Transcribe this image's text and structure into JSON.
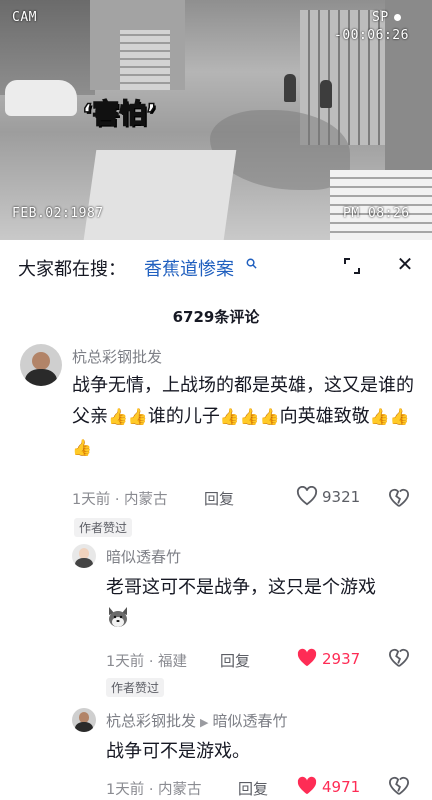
{
  "video": {
    "cam_label": "CAM",
    "sp_label": "SP",
    "time_counter": "-00:06:26",
    "date_stamp": "FEB.02:1987",
    "clock_stamp": "PM 08:26",
    "caption": "‘害怕’"
  },
  "search": {
    "lead": "大家都在搜：",
    "term": "香蕉道惨案",
    "search_icon": "search-icon",
    "expand_icon": "expand-icon",
    "close_icon": "close-icon"
  },
  "comments_count": "6729条评论",
  "comments": [
    {
      "username": "杭总彩钢批发",
      "text_part1": "战争无情，上战场的都是英雄，这又是谁的父亲",
      "text_part2": "谁的儿子",
      "text_part3": "向英雄致敬",
      "thumbs_emoji": "👍",
      "meta": "1天前 · 内蒙古",
      "reply": "回复",
      "likes": "9321",
      "liked": false,
      "author_tag": "作者赞过"
    },
    {
      "username": "暗似透春竹",
      "text": "老哥这可不是战争，这只是个游戏",
      "meta": "1天前 · 福建",
      "reply": "回复",
      "likes": "2937",
      "liked": true,
      "author_tag": "作者赞过"
    },
    {
      "username": "杭总彩钢批发",
      "reply_to": "暗似透春竹",
      "text": "战争可不是游戏。",
      "meta": "1天前 · 内蒙古",
      "reply": "回复",
      "likes": "4971",
      "liked": true
    }
  ],
  "colors": {
    "liked_red": "#fe2c55",
    "search_blue": "#1f5fbf",
    "meta_gray": "#8a8b91"
  }
}
